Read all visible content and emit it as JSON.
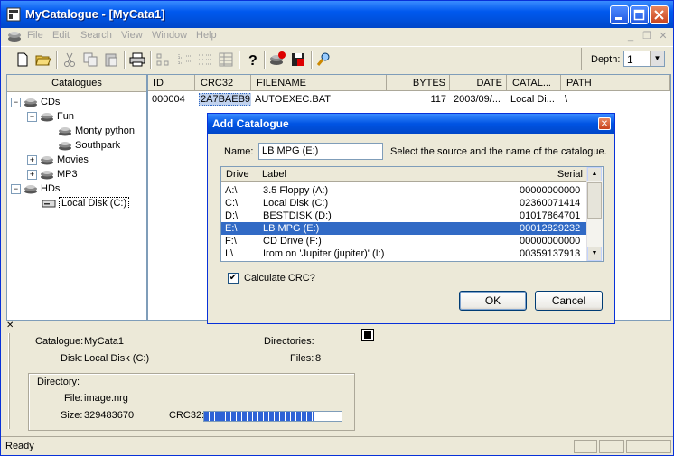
{
  "window": {
    "title": "MyCatalogue - [MyCata1]"
  },
  "menu": [
    "File",
    "Edit",
    "Search",
    "View",
    "Window",
    "Help"
  ],
  "toolbar": {
    "depth_label": "Depth:",
    "depth_value": "1"
  },
  "tree": {
    "header": "Catalogues",
    "nodes": [
      {
        "label": "CDs",
        "expander": "−"
      },
      {
        "label": "Fun",
        "expander": "−"
      },
      {
        "label": "Monty python",
        "expander": ""
      },
      {
        "label": "Southpark",
        "expander": ""
      },
      {
        "label": "Movies",
        "expander": "+"
      },
      {
        "label": "MP3",
        "expander": "+"
      },
      {
        "label": "HDs",
        "expander": "−"
      },
      {
        "label": "Local Disk (C:)",
        "expander": ""
      }
    ]
  },
  "file_list": {
    "columns": [
      "ID",
      "CRC32",
      "FILENAME",
      "BYTES",
      "DATE",
      "CATAL...",
      "PATH"
    ],
    "rows": [
      {
        "id": "000004",
        "crc32": "2A7BAEB9",
        "filename": "AUTOEXEC.BAT",
        "bytes": "117",
        "date": "2003/09/...",
        "catalogue": "Local Di...",
        "path": "\\"
      }
    ]
  },
  "info": {
    "catalogue_label": "Catalogue:",
    "catalogue_value": "MyCata1",
    "disk_label": "Disk:",
    "disk_value": "Local Disk (C:)",
    "directories_label": "Directories:",
    "files_label": "Files:",
    "files_value": "8",
    "directory_label": "Directory:",
    "file_label": "File:",
    "file_value": "image.nrg",
    "size_label": "Size:",
    "size_value": "329483670",
    "crc_label": "CRC32:",
    "crc_progress": 0.8
  },
  "status": {
    "text": "Ready"
  },
  "dialog": {
    "title": "Add Catalogue",
    "name_label": "Name:",
    "name_value": "LB MPG (E:)",
    "hint": "Select the source and the name of the catalogue.",
    "columns": [
      "Drive",
      "Label",
      "Serial"
    ],
    "drives": [
      {
        "drive": "A:\\",
        "label": "3.5 Floppy (A:)",
        "serial": "00000000000"
      },
      {
        "drive": "C:\\",
        "label": "Local Disk (C:)",
        "serial": "02360071414"
      },
      {
        "drive": "D:\\",
        "label": "BESTDISK (D:)",
        "serial": "01017864701"
      },
      {
        "drive": "E:\\",
        "label": "LB MPG (E:)",
        "serial": "00012829232"
      },
      {
        "drive": "F:\\",
        "label": "CD Drive (F:)",
        "serial": "00000000000"
      },
      {
        "drive": "I:\\",
        "label": "Irom on 'Jupiter (jupiter)' (I:)",
        "serial": "00359137913"
      }
    ],
    "selected_index": 3,
    "calc_crc_label": "Calculate CRC?",
    "calc_crc_checked": true,
    "ok_label": "OK",
    "cancel_label": "Cancel"
  }
}
